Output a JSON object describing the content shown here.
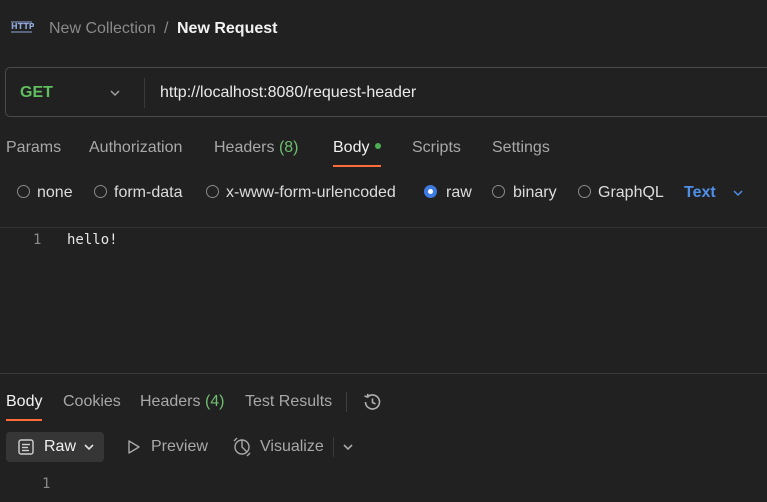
{
  "breadcrumb": {
    "collection": "New Collection",
    "separator": "/",
    "request": "New Request"
  },
  "request": {
    "method": "GET",
    "url": "http://localhost:8080/request-header"
  },
  "request_tabs": {
    "params": "Params",
    "authorization": "Authorization",
    "headers_label": "Headers",
    "headers_count": "(8)",
    "body": "Body",
    "scripts": "Scripts",
    "settings": "Settings"
  },
  "body_modes": {
    "none": "none",
    "form_data": "form-data",
    "urlencoded": "x-www-form-urlencoded",
    "raw": "raw",
    "binary": "binary",
    "graphql": "GraphQL",
    "selected": "raw",
    "raw_type": "Text"
  },
  "editor": {
    "line_number": "1",
    "content": "hello!"
  },
  "response_tabs": {
    "body": "Body",
    "cookies": "Cookies",
    "headers_label": "Headers",
    "headers_count": "(4)",
    "test_results": "Test Results"
  },
  "response_toolbar": {
    "raw": "Raw",
    "preview": "Preview",
    "visualize": "Visualize"
  },
  "response_body": {
    "line_number": "1"
  },
  "colors": {
    "accent": "#ff6c37",
    "method_get": "#5fbf5f",
    "radio_selected": "#3d7be0",
    "text_mode": "#4f8fe8",
    "background": "#212121"
  },
  "icons": [
    "http-icon",
    "chevron-down-icon",
    "history-icon",
    "raw-format-icon",
    "play-icon",
    "visualize-icon"
  ]
}
